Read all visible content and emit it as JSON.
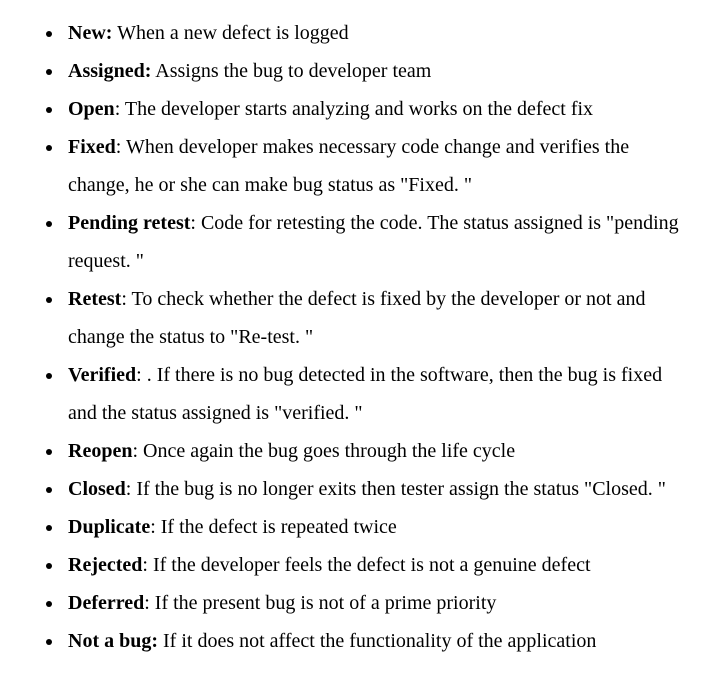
{
  "items": [
    {
      "term": "New:",
      "desc": " When a new defect is logged"
    },
    {
      "term": "Assigned:",
      "desc": " Assigns the bug to developer team"
    },
    {
      "term": "Open",
      "desc": ": The developer starts analyzing and works on the defect fix"
    },
    {
      "term": "Fixed",
      "desc": ": When developer makes necessary code change and verifies the change, he or she can make bug status as \"Fixed. \""
    },
    {
      "term": "Pending retest",
      "desc": ": Code for retesting the code. The status assigned is \"pending request. \""
    },
    {
      "term": "Retest",
      "desc": ": To check whether the defect is fixed by the developer or not and change the status to \"Re-test. \""
    },
    {
      "term": "Verified",
      "desc": ": . If there is no bug detected in the software, then the bug is fixed and the status assigned is \"verified. \""
    },
    {
      "term": "Reopen",
      "desc": ": Once again the bug goes through the life cycle"
    },
    {
      "term": "Closed",
      "desc": ": If the bug is no longer exits then tester assign the status \"Closed. \""
    },
    {
      "term": "Duplicate",
      "desc": ": If the defect is repeated twice"
    },
    {
      "term": "Rejected",
      "desc": ": If the developer feels the defect is not a genuine defect"
    },
    {
      "term": "Deferred",
      "desc": ": If the present bug is not of a prime priority"
    },
    {
      "term": "Not a bug:",
      "desc": " If it does not affect the functionality of the application"
    }
  ]
}
